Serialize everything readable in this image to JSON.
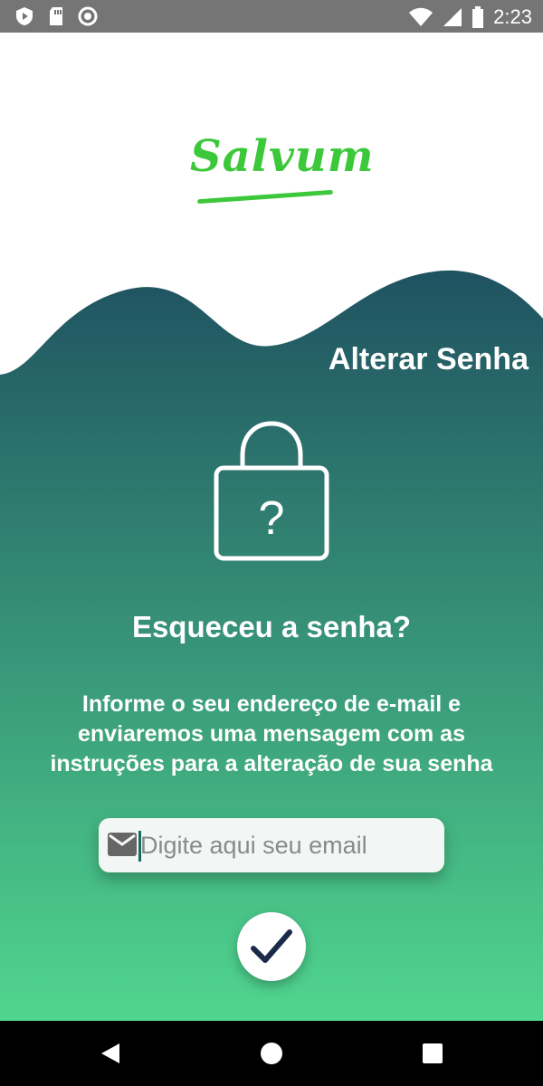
{
  "status_bar": {
    "time": "2:23",
    "left_icons": [
      "play-protect-icon",
      "sd-card-icon",
      "sync-circle-icon"
    ],
    "right_icons": [
      "wifi-icon",
      "signal-icon",
      "battery-icon"
    ]
  },
  "logo": {
    "text": "Salvum",
    "color": "#3cc83a"
  },
  "header": {
    "title": "Alterar Senha"
  },
  "main": {
    "icon": "lock-question-icon",
    "heading": "Esqueceu a senha?",
    "description_lines": [
      "Informe o seu endereço de e-mail e",
      "enviaremos uma mensagem com as",
      "instruções para a alteração de sua senha"
    ]
  },
  "email_field": {
    "icon": "mail-icon",
    "value": "",
    "placeholder": "Digite aqui seu email"
  },
  "confirm_button": {
    "icon": "checkmark-icon"
  },
  "nav_bar": {
    "buttons": [
      "back-icon",
      "home-icon",
      "recents-icon"
    ]
  },
  "colors": {
    "gradient_top": "#1f5261",
    "gradient_bottom": "#50d68e",
    "status_bar": "#757575",
    "checkmark": "#1c2a4a"
  }
}
